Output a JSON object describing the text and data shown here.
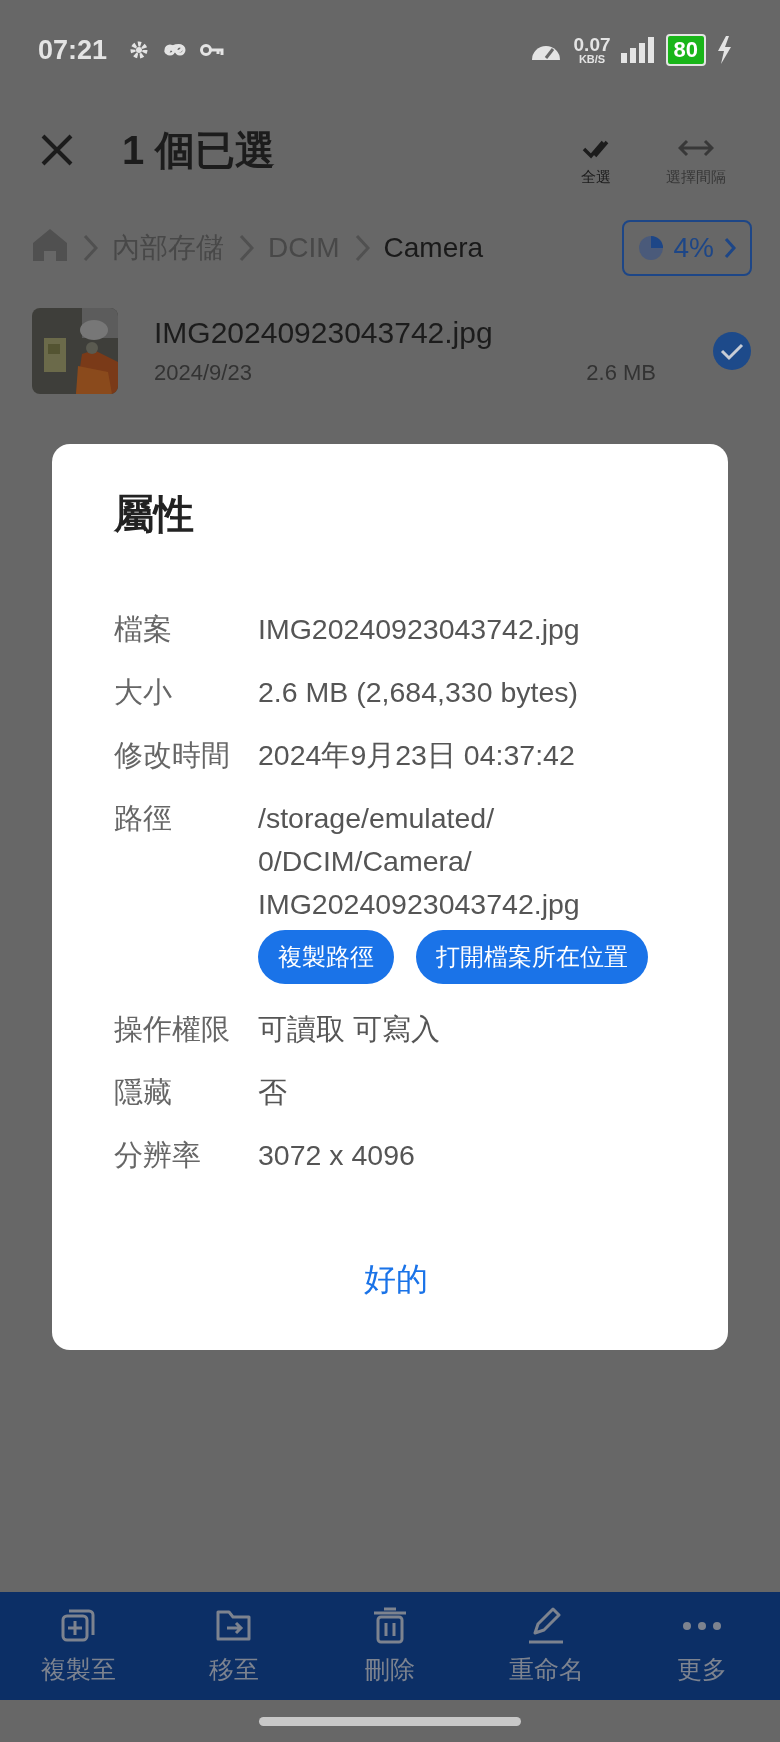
{
  "status_bar": {
    "time": "07:21",
    "net_speed": "0.07",
    "net_unit": "KB/S",
    "battery": "80"
  },
  "header": {
    "title": "1 個已選",
    "actions": [
      {
        "label": "全選",
        "disabled": false
      },
      {
        "label": "選擇間隔",
        "disabled": true
      }
    ]
  },
  "breadcrumb": {
    "items": [
      {
        "label": "內部存儲",
        "current": false
      },
      {
        "label": "DCIM",
        "current": false
      },
      {
        "label": "Camera",
        "current": true
      }
    ],
    "storage": "4%"
  },
  "files": [
    {
      "name": "IMG20240923043742.jpg",
      "date": "2024/9/23",
      "size": "2.6 MB",
      "selected": true
    }
  ],
  "dialog": {
    "title": "屬性",
    "rows": [
      {
        "label": "檔案",
        "value_lines": [
          "IMG20240923043742.jpg"
        ]
      },
      {
        "label": "大小",
        "value_lines": [
          "2.6 MB (2,684,330 bytes)"
        ]
      },
      {
        "label": "修改時間",
        "value_lines": [
          "2024年9月23日 04:37:42"
        ]
      },
      {
        "label": "路徑",
        "value_lines": [
          "/storage/emulated/",
          "0/DCIM/Camera/",
          "IMG20240923043742.jpg"
        ],
        "buttons": [
          "複製路徑",
          "打開檔案所在位置"
        ]
      },
      {
        "label": "操作權限",
        "value_lines": [
          "可讀取 可寫入"
        ]
      },
      {
        "label": "隱藏",
        "value_lines": [
          "否"
        ]
      },
      {
        "label": "分辨率",
        "value_lines": [
          "3072 x 4096"
        ]
      }
    ],
    "ok": "好的"
  },
  "bottom_actions": [
    {
      "label": "複製至"
    },
    {
      "label": "移至"
    },
    {
      "label": "刪除"
    },
    {
      "label": "重命名"
    },
    {
      "label": "更多"
    }
  ]
}
